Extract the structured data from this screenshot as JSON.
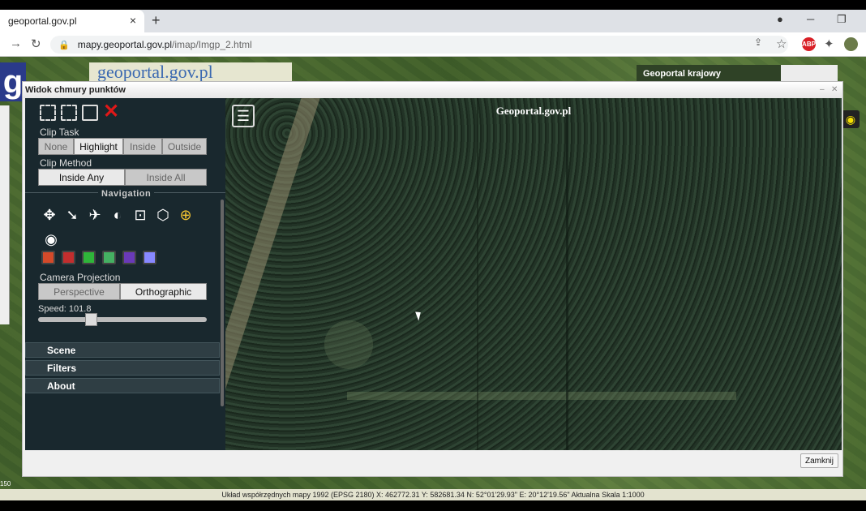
{
  "browser": {
    "tab_title": "geoportal.gov.pl",
    "tab_close": "×",
    "new_tab": "+",
    "url_host": "mapy.geoportal.gov.pl",
    "url_path": "/imap/Imgp_2.html",
    "abp_label": "ABP"
  },
  "page": {
    "logo_letter": "g",
    "banner": "geoportal.gov.pl",
    "krajowy": "Geoportal krajowy",
    "scale_num": "150"
  },
  "dialog": {
    "title": "Widok chmury punktów",
    "close_label": "Zamknij"
  },
  "sidebar": {
    "clip_task_label": "Clip Task",
    "clip_task_options": [
      "None",
      "Highlight",
      "Inside",
      "Outside"
    ],
    "clip_task_selected": "Highlight",
    "clip_method_label": "Clip Method",
    "clip_method_options": [
      "Inside Any",
      "Inside All"
    ],
    "clip_method_selected": "Inside Any",
    "navigation_label": "Navigation",
    "camera_projection_label": "Camera Projection",
    "projection_options": [
      "Perspective",
      "Orthographic"
    ],
    "projection_selected": "Orthographic",
    "speed_label": "Speed: 101.8",
    "speed_level": 0.3,
    "accordion": [
      "Scene",
      "Filters",
      "About"
    ]
  },
  "viewer": {
    "title": "Geoportal.gov.pl"
  },
  "statusbar": {
    "text": "Układ współrzędnych mapy 1992 (EPSG 2180)   X: 462772.31  Y: 582681.34   N: 52°01'29.93\"  E: 20°12'19.56\"   Aktualna Skala 1:1000"
  },
  "colors": {
    "accent_red": "#e01818",
    "potree_bg": "#19282e"
  }
}
